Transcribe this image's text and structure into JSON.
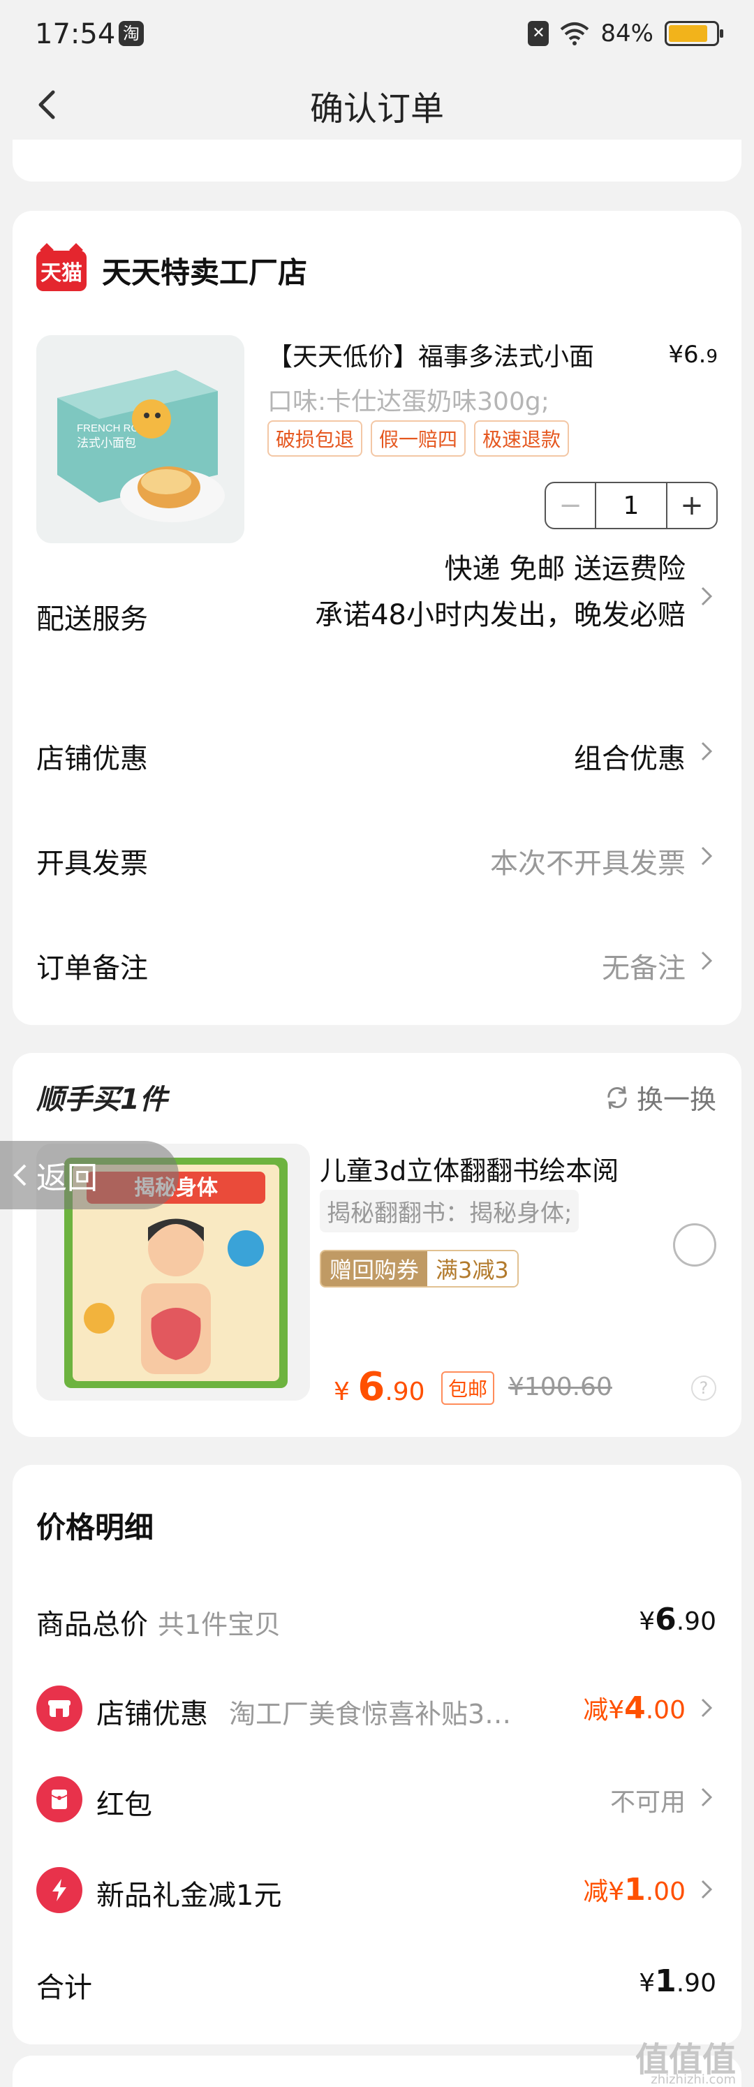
{
  "status": {
    "time": "17:54",
    "battery": "84%"
  },
  "nav": {
    "title": "确认订单"
  },
  "store": {
    "logo": "天猫",
    "name": "天天特卖工厂店",
    "product": {
      "title": "【天天低价】福事多法式小面",
      "price_int": "¥6.",
      "price_dec": "9",
      "sku": "口味:卡仕达蛋奶味300g;",
      "tags": [
        "破损包退",
        "假一赔四",
        "极速退款"
      ],
      "quantity": "1",
      "image_brand": "FRENCH ROLL",
      "image_label": "法式小面包"
    },
    "delivery": {
      "label": "配送服务",
      "line1": "快递 免邮 送运费险",
      "line2": "承诺48小时内发出，晚发必赔"
    },
    "discount": {
      "label": "店铺优惠",
      "value": "组合优惠"
    },
    "invoice": {
      "label": "开具发票",
      "value": "本次不开具发票"
    },
    "note": {
      "label": "订单备注",
      "value": "无备注"
    }
  },
  "extra": {
    "title": "顺手买1件",
    "swap": "换一换",
    "product_title": "儿童3d立体翻翻书绘本阅",
    "sku": "揭秘翻翻书：揭秘身体;",
    "coupon_left": "赠回购券",
    "coupon_right": "满3减3",
    "price_symbol": "¥",
    "price_int": "6",
    "price_dec": ".90",
    "free_ship": "包邮",
    "orig_price": "¥100.60",
    "book_title": "揭秘身体",
    "back": "返回"
  },
  "price": {
    "title": "价格明细",
    "total": {
      "label": "商品总价",
      "sub": "共1件宝贝",
      "symbol": "¥",
      "int": "6",
      "dec": ".90"
    },
    "store_discount": {
      "label": "店铺优惠",
      "sub": "淘工厂美食惊喜补贴3…",
      "prefix": "减",
      "symbol": "¥",
      "int": "4",
      "dec": ".00"
    },
    "red_packet": {
      "label": "红包",
      "value": "不可用"
    },
    "gift": {
      "label": "新品礼金减1元",
      "prefix": "减",
      "symbol": "¥",
      "int": "1",
      "dec": ".00"
    },
    "sum": {
      "label": "合计",
      "symbol": "¥",
      "int": "1",
      "dec": ".90"
    }
  },
  "watermark": {
    "main": "值值值",
    "sub": "zhizhizhi.com"
  },
  "colors": {
    "accent": "#ff5000",
    "tmall": "#e4262e",
    "battery": "#f2b31b"
  }
}
